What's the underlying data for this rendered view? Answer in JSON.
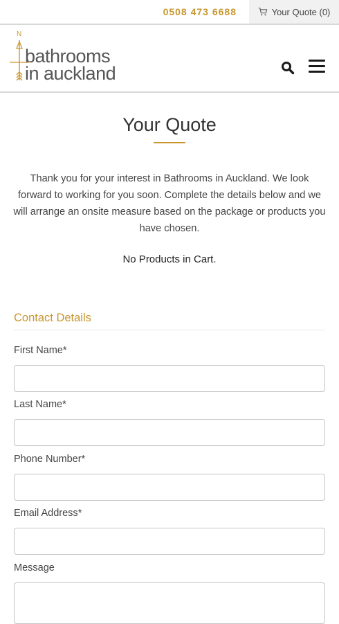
{
  "topbar": {
    "phone": "0508 473 6688",
    "quote_label": "Your Quote (0)"
  },
  "header": {
    "logo_line1": "bathrooms",
    "logo_line2": "in auckland",
    "logo_letter": "N"
  },
  "page": {
    "title": "Your Quote",
    "intro": "Thank you for your interest in Bathrooms in Auckland. We look forward to working for you soon. Complete the details below and we will arrange an onsite measure based on the package or products you have chosen.",
    "empty_cart": "No Products in Cart."
  },
  "form": {
    "section_title": "Contact Details",
    "fields": [
      {
        "label": "First Name",
        "required": "*"
      },
      {
        "label": "Last Name",
        "required": "*"
      },
      {
        "label": "Phone Number",
        "required": "*"
      },
      {
        "label": "Email Address",
        "required": "*"
      },
      {
        "label": "Message",
        "required": ""
      }
    ]
  },
  "colors": {
    "accent": "#c9962e",
    "text": "#444444",
    "border": "#c4c4c4"
  }
}
